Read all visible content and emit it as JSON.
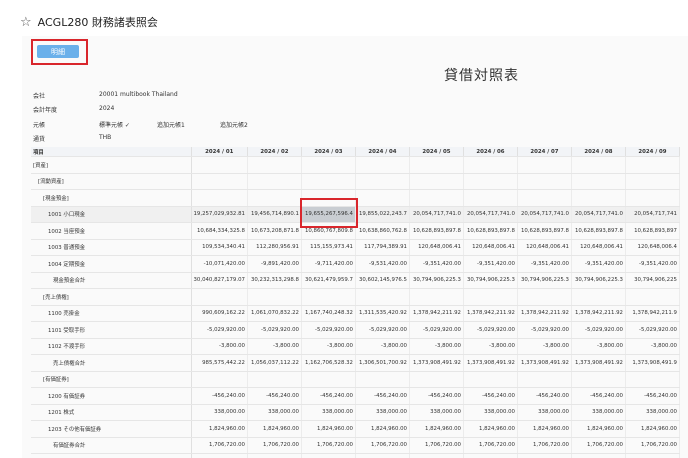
{
  "app": {
    "title": "ACGL280 財務諸表照会"
  },
  "toolbar": {
    "detail_label": "明細"
  },
  "report": {
    "title": "貸借対照表"
  },
  "meta": {
    "company_label": "会社",
    "company_value": "20001 multibook Thailand",
    "year_label": "会計年度",
    "year_value": "2024",
    "ledger_label": "元帳",
    "ledger_tabs": [
      "標準元帳 ✓",
      "追加元帳1",
      "追加元帳2"
    ],
    "currency_label": "通貨",
    "currency_value": "THB"
  },
  "table": {
    "headers": [
      "項目",
      "2024 / 01",
      "2024 / 02",
      "2024 / 03",
      "2024 / 04",
      "2024 / 05",
      "2024 / 06",
      "2024 / 07",
      "2024 / 08",
      "2024 / 09"
    ],
    "rows": [
      {
        "name": "[資産]",
        "indent": 0,
        "values": []
      },
      {
        "name": "[流動資産]",
        "indent": 1,
        "values": []
      },
      {
        "name": "[現金預金]",
        "indent": 2,
        "values": []
      },
      {
        "name": "1001 小口現金",
        "indent": 3,
        "shade": true,
        "values": [
          "19,257,029,932.81",
          "19,456,714,890.1",
          "19,655,267,596.4",
          "19,855,022,243.7",
          "20,054,717,741.0",
          "20,054,717,741.0",
          "20,054,717,741.0",
          "20,054,717,741.0",
          "20,054,717,741"
        ]
      },
      {
        "name": "1002 当座預金",
        "indent": 3,
        "values": [
          "10,684,334,325.8",
          "10,673,208,871.8",
          "10,860,767,809.8",
          "10,638,860,762.8",
          "10,628,893,897.8",
          "10,628,893,897.8",
          "10,628,893,897.8",
          "10,628,893,897.8",
          "10,628,893,897"
        ]
      },
      {
        "name": "1003 普通預金",
        "indent": 3,
        "values": [
          "109,534,340.41",
          "112,280,956.91",
          "115,155,973.41",
          "117,794,389.91",
          "120,648,006.41",
          "120,648,006.41",
          "120,648,006.41",
          "120,648,006.41",
          "120,648,006.4"
        ]
      },
      {
        "name": "1004 定期預金",
        "indent": 3,
        "values": [
          "-10,071,420.00",
          "-9,891,420.00",
          "-9,711,420.00",
          "-9,531,420.00",
          "-9,351,420.00",
          "-9,351,420.00",
          "-9,351,420.00",
          "-9,351,420.00",
          "-9,351,420.00"
        ]
      },
      {
        "name": "現金預金合計",
        "indent": 4,
        "values": [
          "30,040,827,179.07",
          "30,232,313,298.8",
          "30,621,479,959.7",
          "30,602,145,976.5",
          "30,794,906,225.3",
          "30,794,906,225.3",
          "30,794,906,225.3",
          "30,794,906,225.3",
          "30,794,906,225"
        ]
      },
      {
        "name": "[売上債権]",
        "indent": 2,
        "values": []
      },
      {
        "name": "1100 売掛金",
        "indent": 3,
        "values": [
          "990,609,162.22",
          "1,061,070,832.22",
          "1,167,740,248.32",
          "1,311,535,420.92",
          "1,378,942,211.92",
          "1,378,942,211.92",
          "1,378,942,211.92",
          "1,378,942,211.92",
          "1,378,942,211.9"
        ]
      },
      {
        "name": "1101 受取手形",
        "indent": 3,
        "values": [
          "-5,029,920.00",
          "-5,029,920.00",
          "-5,029,920.00",
          "-5,029,920.00",
          "-5,029,920.00",
          "-5,029,920.00",
          "-5,029,920.00",
          "-5,029,920.00",
          "-5,029,920.00"
        ]
      },
      {
        "name": "1102 不渡手形",
        "indent": 3,
        "values": [
          "-3,800.00",
          "-3,800.00",
          "-3,800.00",
          "-3,800.00",
          "-3,800.00",
          "-3,800.00",
          "-3,800.00",
          "-3,800.00",
          "-3,800.00"
        ]
      },
      {
        "name": "売上債権合計",
        "indent": 4,
        "values": [
          "985,575,442.22",
          "1,056,037,112.22",
          "1,162,706,528.32",
          "1,306,501,700.92",
          "1,373,908,491.92",
          "1,373,908,491.92",
          "1,373,908,491.92",
          "1,373,908,491.92",
          "1,373,908,491.9"
        ]
      },
      {
        "name": "[有価証券]",
        "indent": 2,
        "values": []
      },
      {
        "name": "1200 有価証券",
        "indent": 3,
        "values": [
          "-456,240.00",
          "-456,240.00",
          "-456,240.00",
          "-456,240.00",
          "-456,240.00",
          "-456,240.00",
          "-456,240.00",
          "-456,240.00",
          "-456,240.00"
        ]
      },
      {
        "name": "1201 株式",
        "indent": 3,
        "values": [
          "338,000.00",
          "338,000.00",
          "338,000.00",
          "338,000.00",
          "338,000.00",
          "338,000.00",
          "338,000.00",
          "338,000.00",
          "338,000.00"
        ]
      },
      {
        "name": "1203 その他有価証券",
        "indent": 3,
        "values": [
          "1,824,960.00",
          "1,824,960.00",
          "1,824,960.00",
          "1,824,960.00",
          "1,824,960.00",
          "1,824,960.00",
          "1,824,960.00",
          "1,824,960.00",
          "1,824,960.00"
        ]
      },
      {
        "name": "有価証券合計",
        "indent": 4,
        "values": [
          "1,706,720.00",
          "1,706,720.00",
          "1,706,720.00",
          "1,706,720.00",
          "1,706,720.00",
          "1,706,720.00",
          "1,706,720.00",
          "1,706,720.00",
          "1,706,720.00"
        ]
      },
      {
        "name": "[棚卸資産]",
        "indent": 2,
        "values": []
      }
    ]
  }
}
